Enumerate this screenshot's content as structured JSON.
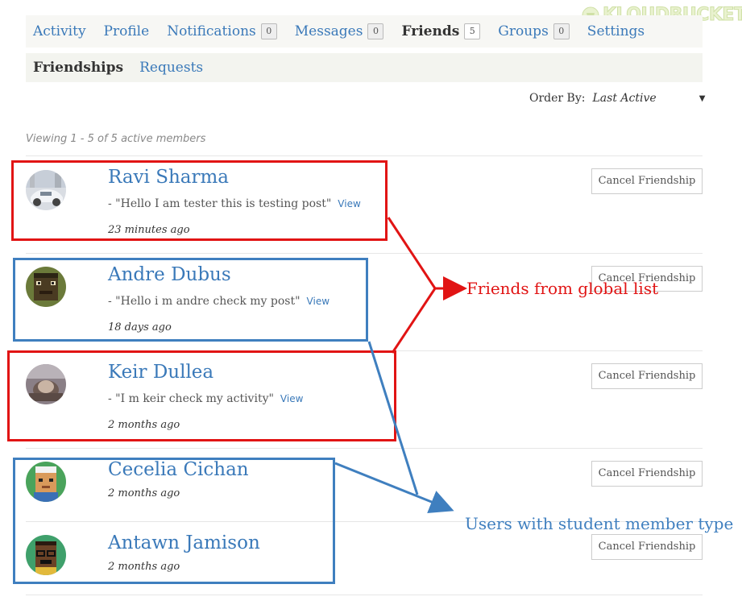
{
  "logo": {
    "text": "KLOUDBUCKET"
  },
  "primary_nav": [
    {
      "label": "Activity",
      "count": null,
      "active": false
    },
    {
      "label": "Profile",
      "count": null,
      "active": false
    },
    {
      "label": "Notifications",
      "count": "0",
      "active": false
    },
    {
      "label": "Messages",
      "count": "0",
      "active": false
    },
    {
      "label": "Friends",
      "count": "5",
      "active": true
    },
    {
      "label": "Groups",
      "count": "0",
      "active": false
    },
    {
      "label": "Settings",
      "count": null,
      "active": false
    }
  ],
  "sub_nav": [
    {
      "label": "Friendships",
      "active": true
    },
    {
      "label": "Requests",
      "active": false
    }
  ],
  "order_by": {
    "label": "Order By:",
    "value": "Last Active"
  },
  "viewing_text": "Viewing 1 - 5 of 5 active members",
  "members": [
    {
      "name": "Ravi Sharma",
      "update": "- \"Hello I am tester this is testing post\"",
      "view": "View",
      "time": "23 minutes ago",
      "button": "Cancel Friendship"
    },
    {
      "name": "Andre Dubus",
      "update": "- \"Hello i m andre check my post\"",
      "view": "View",
      "time": "18 days ago",
      "button": "Cancel Friendship"
    },
    {
      "name": "Keir Dullea",
      "update": "- \"I m keir check my activity\"",
      "view": "View",
      "time": "2 months ago",
      "button": "Cancel Friendship"
    },
    {
      "name": "Cecelia Cichan",
      "time": "2 months ago",
      "button": "Cancel Friendship"
    },
    {
      "name": "Antawn Jamison",
      "time": "2 months ago",
      "button": "Cancel Friendship"
    }
  ],
  "annotations": {
    "global_list": "Friends from global list",
    "student_type": "Users with student member type",
    "red_color": "#e11414",
    "blue_color": "#3f7fbf"
  }
}
